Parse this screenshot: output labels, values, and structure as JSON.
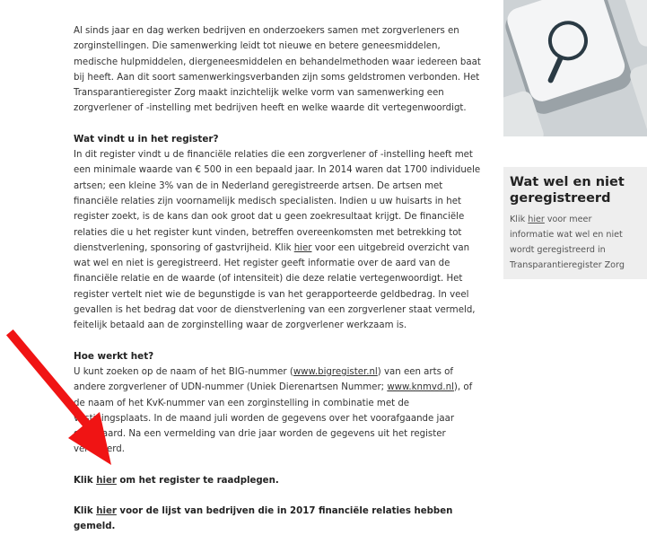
{
  "intro": "Al sinds jaar en dag werken bedrijven en onderzoekers samen met zorgverleners en zorginstellingen. Die samenwerking leidt tot nieuwe en betere geneesmiddelen, medische hulpmiddelen, diergeneesmiddelen en behandelmethoden waar iedereen baat bij heeft. Aan dit soort samenwerkingsverbanden zijn soms geldstromen verbonden. Het Transparantieregister Zorg maakt inzichtelijk welke vorm van samenwerking een zorgverlener of -instelling met bedrijven heeft en welke waarde dit vertegenwoordigt.",
  "section1": {
    "heading": "Wat vindt u in het register?",
    "text_before_link": "In dit register vindt u de financiële relaties die een zorgverlener of -instelling heeft met een minimale waarde van € 500 in een bepaald jaar. In 2014 waren dat 1700 individuele artsen; een kleine 3% van de in Nederland geregistreerde artsen. De artsen met financiële relaties zijn voornamelijk medisch specialisten. Indien u uw huisarts in het register zoekt, is de kans dan ook groot dat u geen zoekresultaat krijgt. De financiële relaties die u het register kunt vinden, betreffen overeenkomsten met betrekking tot dienstverlening, sponsoring of gastvrijheid. Klik ",
    "link": "hier",
    "text_after_link": " voor een uitgebreid overzicht van wat wel en niet is geregistreerd. Het register geeft informatie over de aard van de financiële relatie en de waarde (of intensiteit) die deze relatie vertegenwoordigt. Het register vertelt niet wie de begunstigde is van het gerapporteerde geldbedrag. In veel gevallen is het bedrag dat voor de dienstverlening van een zorgverlener staat vermeld, feitelijk betaald aan de zorginstelling waar de zorgverlener werkzaam is."
  },
  "section2": {
    "heading": "Hoe werkt het?",
    "text1": "U kunt zoeken op de naam of het BIG-nummer (",
    "link1": "www.bigregister.nl",
    "text2": ") van een arts of andere zorgverlener of UDN-nummer (Uniek Dierenartsen Nummer; ",
    "link2": "www.knmvd.nl",
    "text3": "), of de naam of het KvK-nummer van een zorginstelling in combinatie met de vestigingsplaats. In de maand juli worden de gegevens over het voorafgaande jaar openbaard. Na een vermelding van drie jaar worden de gegevens uit het register verwijderd."
  },
  "cta1": {
    "before": "Klik ",
    "link": "hier",
    "after": " om het register te raadplegen."
  },
  "cta2": {
    "before": "Klik ",
    "link": "hier",
    "after": " voor de lijst van bedrijven die in 2017 financiële relaties hebben gemeld."
  },
  "sidebar": {
    "heading": "Wat wel en niet geregistreerd",
    "text_before": "Klik ",
    "link": "hier",
    "text_after": " voor meer informatie wat wel en niet wordt geregistreerd in Transparantieregister Zorg"
  },
  "image": {
    "subject": "magnifier-key-icon"
  },
  "colors": {
    "arrow": "#f01414",
    "sidebar_bg": "#eeeeee",
    "text": "#333333"
  }
}
